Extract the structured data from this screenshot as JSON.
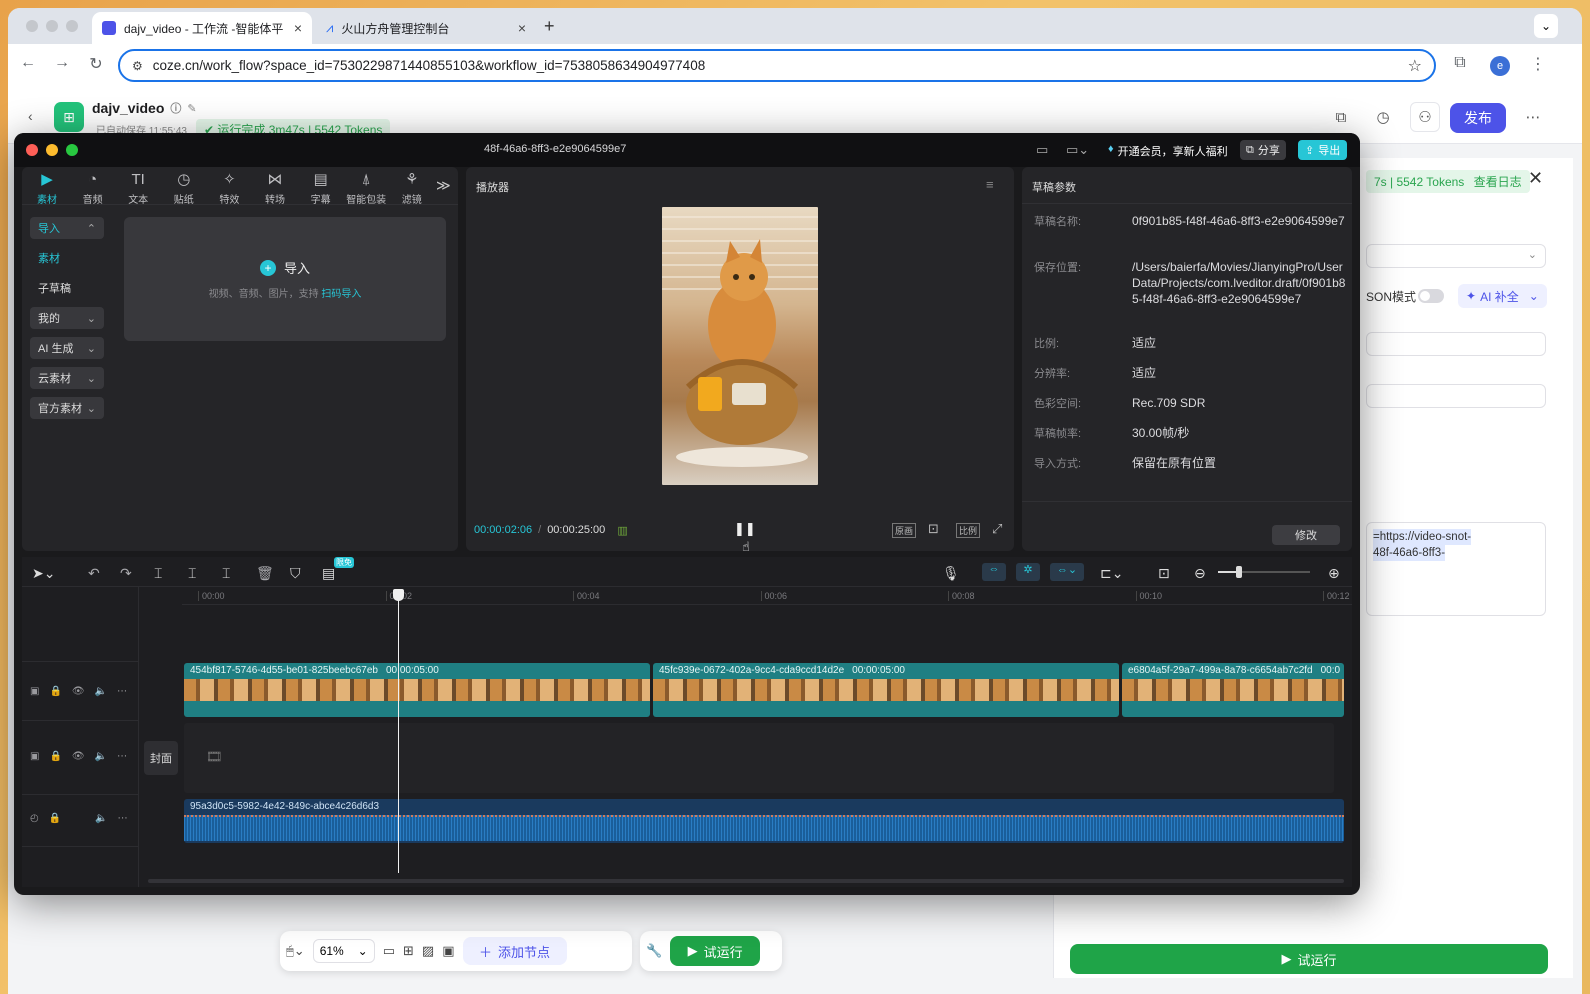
{
  "browser": {
    "tabs": [
      {
        "title": "dajv_video - 工作流 -智能体平",
        "active": true
      },
      {
        "title": "火山方舟管理控制台",
        "active": false
      }
    ],
    "new_tab": "+",
    "url": "coze.cn/work_flow?space_id=7530229871440855103&workflow_id=7538058634904977408",
    "profile_initial": "e"
  },
  "coze": {
    "project_name": "dajv_video",
    "autosave": "已自动保存 11:55:43",
    "run_status": "运行完成 3m47s | 5542 Tokens",
    "publish_label": "发布",
    "side": {
      "run_summary": "7s | 5542 Tokens",
      "view_log": "查看日志",
      "json_mode": "SON模式",
      "ai_complete": "AI 补全",
      "output_text_1": "=https://video-snot-",
      "output_text_2": "48f-46a6-8ff3-",
      "test_run": "试运行"
    },
    "bottombar": {
      "zoom": "61%",
      "add_node": "添加节点",
      "test_run": "试运行"
    }
  },
  "editor": {
    "title": "48f-46a6-8ff3-e2e9064599e7",
    "vip_text": "开通会员，享新人福利",
    "share": "分享",
    "export": "导出",
    "tool_tabs": [
      {
        "label": "素材",
        "icon": "▶"
      },
      {
        "label": "音频",
        "icon": "◔"
      },
      {
        "label": "文本",
        "icon": "TI"
      },
      {
        "label": "贴纸",
        "icon": "◷"
      },
      {
        "label": "特效",
        "icon": "✧"
      },
      {
        "label": "转场",
        "icon": "⋈"
      },
      {
        "label": "字幕",
        "icon": "▤"
      },
      {
        "label": "智能包装",
        "icon": "⍋"
      },
      {
        "label": "滤镜",
        "icon": "⚘"
      }
    ],
    "more": "≫",
    "left_nav": [
      {
        "label": "导入",
        "arrow": "⌃",
        "boxed": true,
        "active": true
      },
      {
        "label": "素材",
        "arrow": "",
        "boxed": false,
        "active": true
      },
      {
        "label": "子草稿",
        "arrow": "",
        "boxed": false,
        "active": false
      },
      {
        "label": "我的",
        "arrow": "⌄",
        "boxed": true,
        "active": false
      },
      {
        "label": "AI 生成",
        "arrow": "⌄",
        "boxed": true,
        "active": false
      },
      {
        "label": "云素材",
        "arrow": "⌄",
        "boxed": true,
        "active": false
      },
      {
        "label": "官方素材",
        "arrow": "⌄",
        "boxed": true,
        "active": false
      }
    ],
    "import_box": {
      "title": "导入",
      "desc": "视频、音频、图片，支持",
      "link": "扫码导入"
    },
    "player": {
      "title": "播放器",
      "current_time": "00:00:02:06",
      "separator": "/",
      "total_time": "00:00:25:00",
      "btn_original": "原画",
      "btn_ratio": "比例"
    },
    "props": {
      "title": "草稿参数",
      "rows": [
        {
          "label": "草稿名称:",
          "value": "0f901b85-f48f-46a6-8ff3-e2e9064599e7"
        },
        {
          "label": "保存位置:",
          "value": "/Users/baierfa/Movies/JianyingPro/User Data/Projects/com.lveditor.draft/0f901b85-f48f-46a6-8ff3-e2e9064599e7"
        },
        {
          "label": "比例:",
          "value": "适应"
        },
        {
          "label": "分辨率:",
          "value": "适应"
        },
        {
          "label": "色彩空间:",
          "value": "Rec.709 SDR"
        },
        {
          "label": "草稿帧率:",
          "value": "30.00帧/秒"
        },
        {
          "label": "导入方式:",
          "value": "保留在原有位置"
        }
      ],
      "modify": "修改"
    },
    "timeline": {
      "limited_badge": "限免",
      "ruler": [
        "00:00",
        "00:02",
        "00:04",
        "00:06",
        "00:08",
        "00:10",
        "00:12"
      ],
      "cover_label": "封面",
      "clips": [
        {
          "id": "454bf817-5746-4d55-be01-825beebc67eb",
          "duration": "00:00:05:00"
        },
        {
          "id": "45fc939e-0672-402a-9cc4-cda9ccd14d2e",
          "duration": "00:00:05:00"
        },
        {
          "id": "e6804a5f-29a7-499a-8a78-c6654ab7c2fd",
          "duration": "00:0"
        }
      ],
      "audio_clip": "95a3d0c5-5982-4e42-849c-abce4c26d6d3"
    }
  },
  "colors": {
    "accent_cyan": "#27c6d6",
    "coze_green": "#1fa448",
    "publish_blue": "#4d53e8",
    "clip_teal": "#1f7f83",
    "audio_blue": "#1a5e9a"
  }
}
